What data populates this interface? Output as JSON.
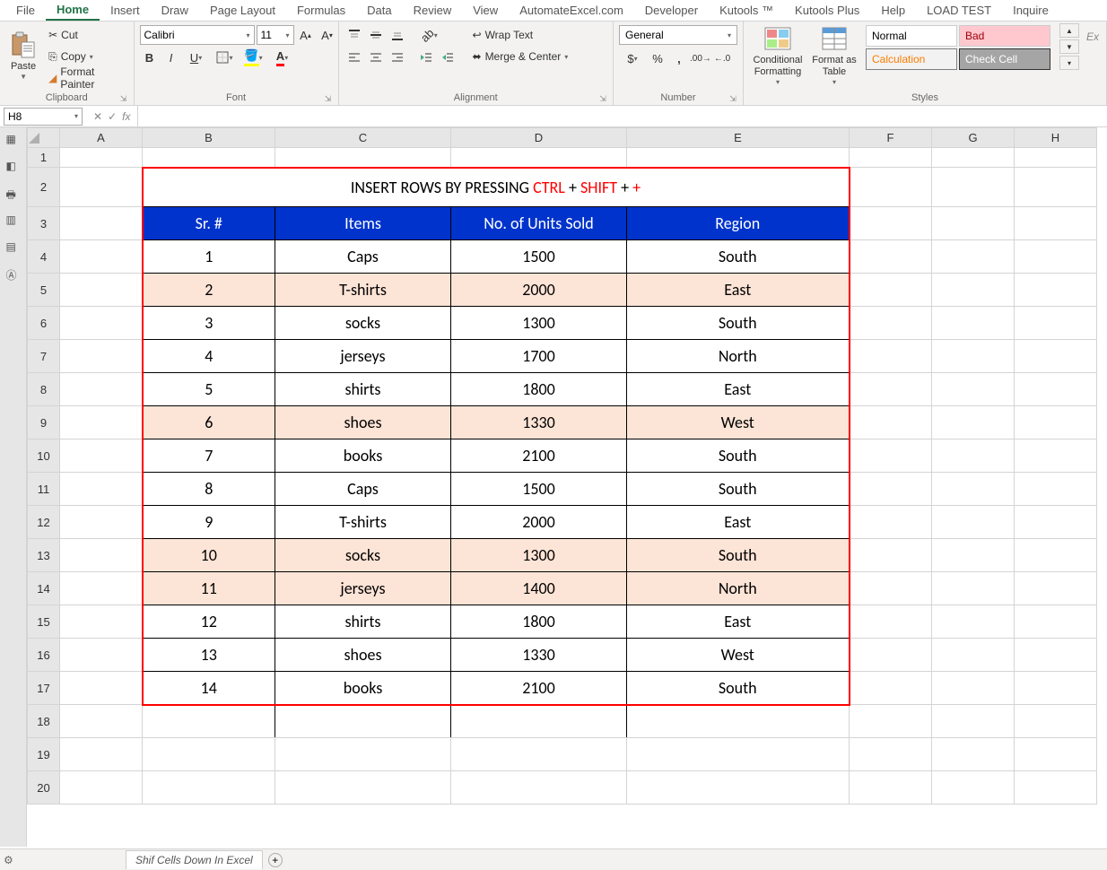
{
  "tabs": [
    "File",
    "Home",
    "Insert",
    "Draw",
    "Page Layout",
    "Formulas",
    "Data",
    "Review",
    "View",
    "AutomateExcel.com",
    "Developer",
    "Kutools ™",
    "Kutools Plus",
    "Help",
    "LOAD TEST",
    "Inquire"
  ],
  "activeTab": "Home",
  "clipboard": {
    "paste": "Paste",
    "cut": "Cut",
    "copy": "Copy",
    "format_painter": "Format Painter",
    "group": "Clipboard"
  },
  "font": {
    "name": "Calibri",
    "size": "11",
    "group": "Font"
  },
  "alignment": {
    "wrap": "Wrap Text",
    "merge": "Merge & Center",
    "group": "Alignment"
  },
  "number": {
    "format": "General",
    "group": "Number"
  },
  "styles": {
    "cond": "Conditional Formatting",
    "table": "Format as Table",
    "normal": "Normal",
    "bad": "Bad",
    "calc": "Calculation",
    "check": "Check Cell",
    "ex": "Ex",
    "group": "Styles"
  },
  "namebox": "H8",
  "cols": [
    "A",
    "B",
    "C",
    "D",
    "E",
    "F",
    "G",
    "H"
  ],
  "colG_extra": "G",
  "rows": [
    "1",
    "2",
    "3",
    "4",
    "5",
    "6",
    "7",
    "8",
    "9",
    "10",
    "11",
    "12",
    "13",
    "14",
    "15",
    "16",
    "17",
    "18",
    "19",
    "20"
  ],
  "title": {
    "pre": "INSERT ROWS BY PRESSING ",
    "k1": "CTRL",
    "plus1": " + ",
    "k2": "SHIFT",
    "plus2": " + ",
    "k3": "+"
  },
  "headers": {
    "sr": "Sr. #",
    "items": "Items",
    "units": "No. of Units Sold",
    "region": "Region"
  },
  "data": [
    {
      "sr": "1",
      "item": "Caps",
      "units": "1500",
      "region": "South",
      "peach": false
    },
    {
      "sr": "2",
      "item": "T-shirts",
      "units": "2000",
      "region": "East",
      "peach": true
    },
    {
      "sr": "3",
      "item": "socks",
      "units": "1300",
      "region": "South",
      "peach": false
    },
    {
      "sr": "4",
      "item": "jerseys",
      "units": "1700",
      "region": "North",
      "peach": false
    },
    {
      "sr": "5",
      "item": "shirts",
      "units": "1800",
      "region": "East",
      "peach": false
    },
    {
      "sr": "6",
      "item": "shoes",
      "units": "1330",
      "region": "West",
      "peach": true
    },
    {
      "sr": "7",
      "item": "books",
      "units": "2100",
      "region": "South",
      "peach": false
    },
    {
      "sr": "8",
      "item": "Caps",
      "units": "1500",
      "region": "South",
      "peach": false
    },
    {
      "sr": "9",
      "item": "T-shirts",
      "units": "2000",
      "region": "East",
      "peach": false
    },
    {
      "sr": "10",
      "item": "socks",
      "units": "1300",
      "region": "South",
      "peach": true
    },
    {
      "sr": "11",
      "item": "jerseys",
      "units": "1400",
      "region": "North",
      "peach": true
    },
    {
      "sr": "12",
      "item": "shirts",
      "units": "1800",
      "region": "East",
      "peach": false
    },
    {
      "sr": "13",
      "item": "shoes",
      "units": "1330",
      "region": "West",
      "peach": false
    },
    {
      "sr": "14",
      "item": "books",
      "units": "2100",
      "region": "South",
      "peach": false
    }
  ],
  "sheet_tab": "Shif Cells Down In Excel"
}
